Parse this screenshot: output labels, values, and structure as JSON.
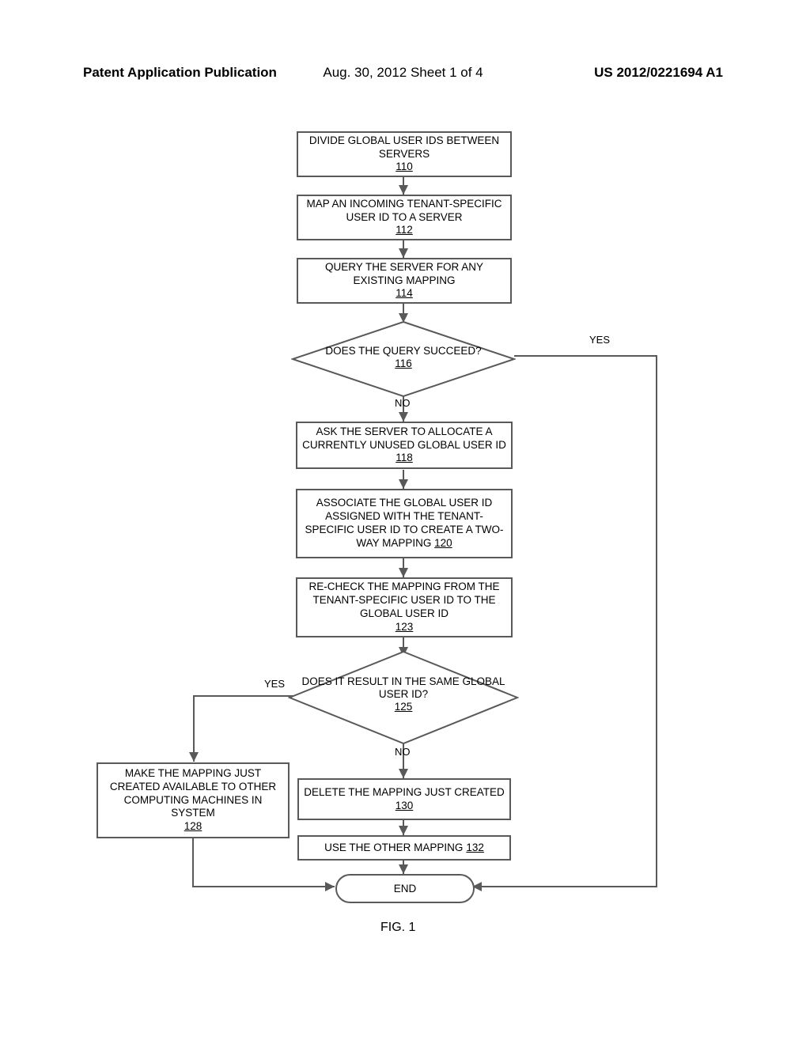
{
  "header": {
    "left": "Patent Application Publication",
    "center": "Aug. 30, 2012  Sheet 1 of 4",
    "right": "US 2012/0221694 A1"
  },
  "figure_caption": "FIG. 1",
  "labels": {
    "yes_top": "YES",
    "no_top": "NO",
    "yes_bottom": "YES",
    "no_bottom": "NO"
  },
  "nodes": {
    "n110": {
      "text": "DIVIDE GLOBAL USER IDS BETWEEN SERVERS",
      "ref": "110"
    },
    "n112": {
      "text": "MAP AN INCOMING TENANT-SPECIFIC USER ID TO A SERVER",
      "ref": "112"
    },
    "n114": {
      "text": "QUERY THE SERVER FOR ANY EXISTING MAPPING",
      "ref": "114"
    },
    "d116": {
      "text": "DOES THE QUERY SUCCEED?",
      "ref": "116"
    },
    "n118": {
      "text": "ASK THE SERVER TO ALLOCATE A CURRENTLY UNUSED GLOBAL USER ID",
      "ref": "118"
    },
    "n120": {
      "text": "ASSOCIATE THE GLOBAL USER ID ASSIGNED WITH THE TENANT-SPECIFIC USER ID TO CREATE A TWO-WAY MAPPING",
      "ref": "120"
    },
    "n123": {
      "text": "RE-CHECK THE MAPPING FROM THE TENANT-SPECIFIC USER ID TO THE GLOBAL USER ID",
      "ref": "123"
    },
    "d125": {
      "text": "DOES IT RESULT IN THE SAME GLOBAL USER ID?",
      "ref": "125"
    },
    "n128": {
      "text": "MAKE THE MAPPING JUST CREATED AVAILABLE TO OTHER COMPUTING MACHINES IN SYSTEM",
      "ref": "128"
    },
    "n130": {
      "text": "DELETE THE MAPPING JUST CREATED",
      "ref": "130"
    },
    "n132": {
      "text_pre": "USE THE OTHER MAPPING ",
      "ref": "132"
    },
    "end": {
      "text": "END"
    }
  }
}
